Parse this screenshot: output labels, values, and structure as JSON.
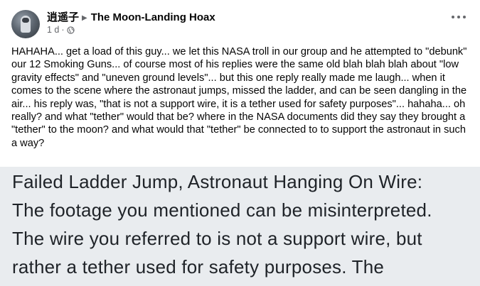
{
  "post": {
    "author": "逍遥子",
    "arrow_icon": "triangle-right-icon",
    "group": "The Moon-Landing Hoax",
    "time": "1 d",
    "dot": "·",
    "privacy_icon": "globe-icon",
    "more_icon": "more-options-icon",
    "text": "HAHAHA... get a load of this guy... we let this NASA troll in our group and he attempted to \"debunk\" our 12 Smoking Guns... of course most of his replies were the same old blah blah blah about \"low gravity effects\" and \"uneven ground levels\"... but this one reply really made me laugh... when it comes to the scene where the astronaut jumps, missed the ladder, and can be seen dangling in the air... his reply was, \"that is not a support wire, it is a tether used for safety purposes\"... hahaha... oh really? and what \"tether\" would that be? where in the NASA documents did they say they brought a \"tether\" to the moon? and what would that \"tether\" be connected to to support the astronaut in such a way?"
  },
  "screenshot": {
    "lines": [
      "Failed Ladder Jump, Astronaut Hanging On Wire:",
      "The footage you mentioned can be misinterpreted.",
      "The wire you referred to is not a support wire, but",
      "rather a tether used for safety purposes. The"
    ]
  }
}
